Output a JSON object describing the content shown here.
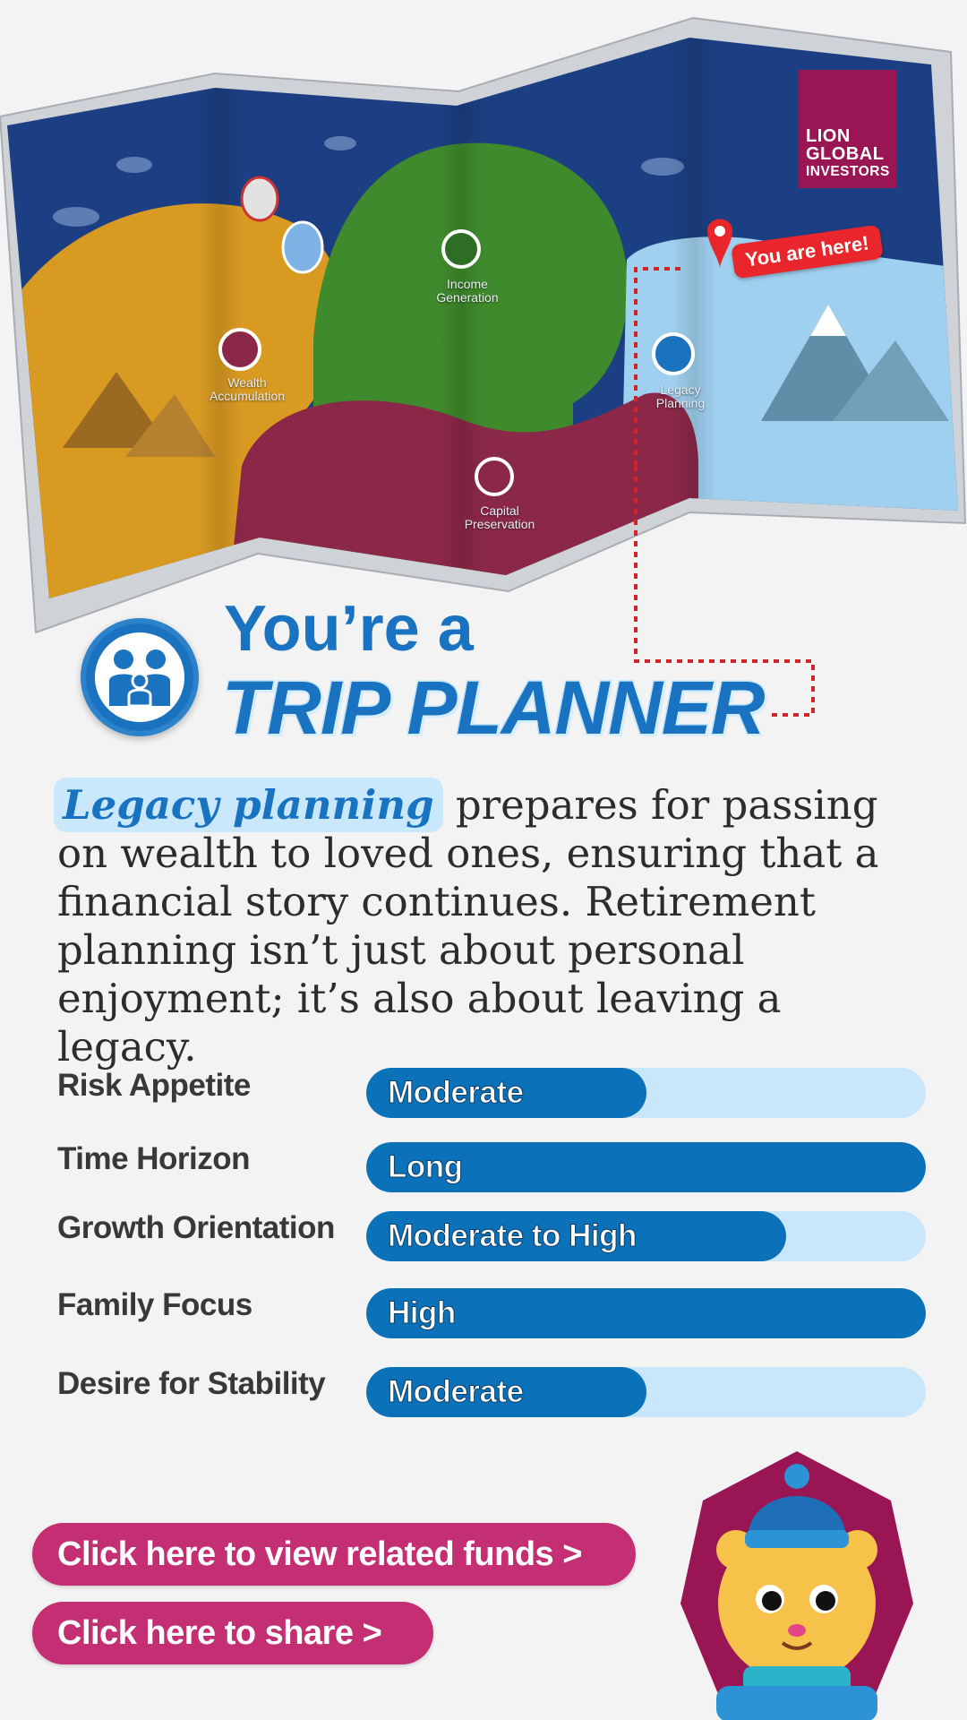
{
  "brand": {
    "line1": "LION",
    "line2": "GLOBAL",
    "line3": "INVESTORS"
  },
  "map": {
    "you_are_here": "You are here!",
    "regions": {
      "wealth_accumulation": "Wealth Accumulation",
      "income_generation": "Income Generation",
      "legacy_planning": "Legacy Planning",
      "capital_preservation": "Capital Preservation"
    },
    "colors": {
      "sky": "#1b3f82",
      "desert": "#d99a22",
      "hills": "#3f8a2c",
      "city": "#8b2847",
      "snow": "#9fd0ef"
    }
  },
  "title": {
    "line1": "You’re a",
    "line2": "TRIP PLANNER",
    "icon": "family-icon"
  },
  "intro": {
    "highlight": "Legacy planning",
    "text": " prepares for passing on wealth to loved ones, ensuring that a financial story continues. Retirement planning isn’t just about personal enjoyment; it’s also about leaving a legacy."
  },
  "traits": [
    {
      "label": "Risk Appetite",
      "value": "Moderate",
      "level": 0.5
    },
    {
      "label": "Time Horizon",
      "value": "Long",
      "level": 1.0
    },
    {
      "label": "Growth Orientation",
      "value": "Moderate to High",
      "level": 0.75
    },
    {
      "label": "Family Focus",
      "value": "High",
      "level": 1.0
    },
    {
      "label": "Desire for Stability",
      "value": "Moderate",
      "level": 0.5
    }
  ],
  "actions": {
    "view_funds": "Click here to view related funds >",
    "share": "Click here to share  >"
  },
  "accent_colors": {
    "primary_blue": "#1a73c0",
    "bar_fill": "#0b71b8",
    "bar_track": "#c9e7fb",
    "cta": "#c42e73"
  }
}
